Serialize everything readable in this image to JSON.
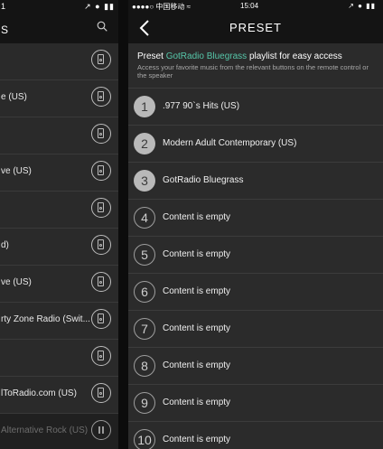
{
  "left": {
    "status_time": "1",
    "status_icons": "↗ ● ▮▮",
    "title": "S",
    "rows": [
      {
        "label": ""
      },
      {
        "label": "e (US)"
      },
      {
        "label": ""
      },
      {
        "label": "ve (US)"
      },
      {
        "label": ""
      },
      {
        "label": "d)"
      },
      {
        "label": "ve (US)"
      },
      {
        "label": "rty Zone Radio (Swit..."
      },
      {
        "label": ""
      },
      {
        "label": "lToRadio.com (US)"
      },
      {
        "label": "Alternative Rock (US)"
      }
    ]
  },
  "status": {
    "carrier": "●●●●○ 中国移动 ≈",
    "time": "15:04",
    "icons": "↗ ● ▮▮"
  },
  "nav": {
    "title": "PRESET"
  },
  "intro": {
    "prefix": "Preset ",
    "highlight": "GotRadio Bluegrass",
    "suffix": " playlist for easy access",
    "description": "Access your favorite music from the relevant buttons on the remote control or the speaker"
  },
  "presets": [
    {
      "number": "1",
      "label": ".977 90`s Hits (US)",
      "state": "filled"
    },
    {
      "number": "2",
      "label": "Modern Adult Contemporary (US)",
      "state": "filled"
    },
    {
      "number": "3",
      "label": "GotRadio Bluegrass",
      "state": "filled"
    },
    {
      "number": "4",
      "label": "Content is empty",
      "state": "empty"
    },
    {
      "number": "5",
      "label": "Content is empty",
      "state": "empty"
    },
    {
      "number": "6",
      "label": "Content is empty",
      "state": "empty"
    },
    {
      "number": "7",
      "label": "Content is empty",
      "state": "empty"
    },
    {
      "number": "8",
      "label": "Content is empty",
      "state": "empty"
    },
    {
      "number": "9",
      "label": "Content is empty",
      "state": "empty"
    },
    {
      "number": "10",
      "label": "Content is empty",
      "state": "empty"
    }
  ]
}
